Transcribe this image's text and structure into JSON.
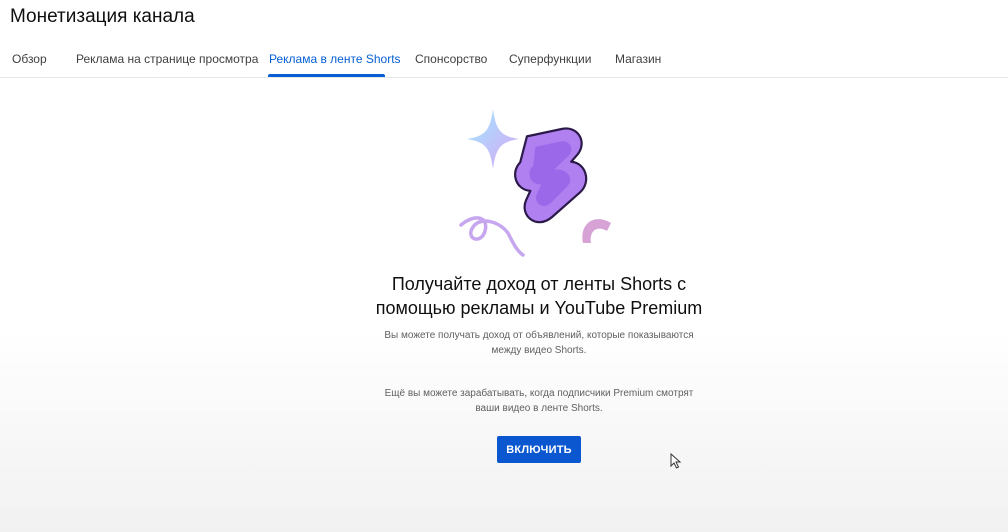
{
  "page": {
    "title": "Монетизация канала"
  },
  "tabs": [
    {
      "label": "Обзор"
    },
    {
      "label": "Реклама на странице просмотра"
    },
    {
      "label": "Реклама в ленте Shorts"
    },
    {
      "label": "Спонсорство"
    },
    {
      "label": "Суперфункции"
    },
    {
      "label": "Магазин"
    }
  ],
  "active_tab": "Реклама в ленте Shorts",
  "main": {
    "headline_line1": "Получайте доход от ленты Shorts с",
    "headline_line2": "помощью рекламы и YouTube Premium",
    "description1_line1": "Вы можете получать доход от объявлений, которые показываются",
    "description1_line2": "между видео Shorts.",
    "description2_line1": "Ещё вы можете зарабатывать, когда подписчики Premium смотрят",
    "description2_line2": "ваши видео в ленте Shorts.",
    "enable_button": "ВКЛЮЧИТЬ"
  },
  "colors": {
    "accent": "#065fd4",
    "button": "#0b57d0",
    "shorts_logo_fill": "#b07ff0",
    "shorts_logo_inner": "#8c55e6"
  },
  "icons": {
    "illustration": "shorts-logo-icon",
    "cursor": "mouse-pointer-icon"
  }
}
